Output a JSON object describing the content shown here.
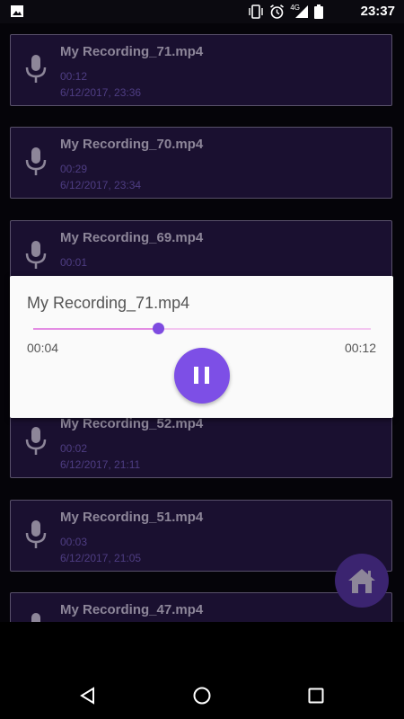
{
  "status_bar": {
    "time": "23:37",
    "network": "4G",
    "icons": [
      "gallery-icon",
      "vibrate-icon",
      "alarm-icon",
      "signal-icon",
      "battery-icon"
    ]
  },
  "recordings": [
    {
      "name": "My Recording_71.mp4",
      "duration": "00:12",
      "date": "6/12/2017, 23:36"
    },
    {
      "name": "My Recording_70.mp4",
      "duration": "00:29",
      "date": "6/12/2017, 23:34"
    },
    {
      "name": "My Recording_69.mp4",
      "duration": "00:01",
      "date": ""
    },
    {
      "name": "My Recording_52.mp4",
      "duration": "00:02",
      "date": "6/12/2017, 21:11"
    },
    {
      "name": "My Recording_51.mp4",
      "duration": "00:03",
      "date": "6/12/2017, 21:05"
    },
    {
      "name": "My Recording_47.mp4",
      "duration": "",
      "date": ""
    }
  ],
  "player": {
    "title": "My Recording_71.mp4",
    "current_time": "00:04",
    "total_time": "00:12",
    "progress": 0.37,
    "state_icon": "pause-icon"
  },
  "fab": {
    "icon": "home-icon"
  },
  "nav": {
    "icons": [
      "back-icon",
      "home-circle-icon",
      "recents-icon"
    ]
  },
  "colors": {
    "card_bg": "#1a1030",
    "accent": "#7d4fe6",
    "fab": "#3b2470",
    "track": "#e38de3"
  }
}
